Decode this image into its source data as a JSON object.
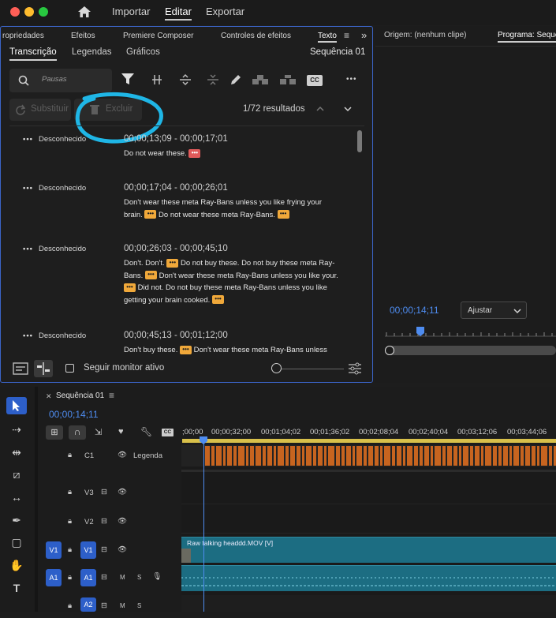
{
  "menu": {
    "items": [
      "Importar",
      "Editar",
      "Exportar"
    ],
    "active": "Editar"
  },
  "panel_tabs": [
    "ropriedades",
    "Efeitos",
    "Premiere Composer",
    "Controles de efeitos",
    "Texto",
    "≡",
    "»"
  ],
  "sub_tabs": {
    "items": [
      "Transcrição",
      "Legendas",
      "Gráficos"
    ],
    "active": "Transcrição",
    "sequence": "Sequência 01"
  },
  "search": {
    "placeholder": "Pausas"
  },
  "toolbar": {
    "cc_label": "CC",
    "more": "•••"
  },
  "actions": {
    "replace_label": "Substituir",
    "delete_label": "Excluir",
    "results": "1/72 resultados"
  },
  "transcript": [
    {
      "speaker": "Desconhecido",
      "timecode": "00;00;13;09 - 00;00;17;01",
      "lines": [
        "Do not wear these. [red]"
      ]
    },
    {
      "speaker": "Desconhecido",
      "timecode": "00;00;17;04 - 00;00;26;01",
      "lines": [
        "Don't wear these meta Ray-Bans unless you like frying your",
        "brain. [p] Do not wear these meta Ray-Bans. [p]"
      ]
    },
    {
      "speaker": "Desconhecido",
      "timecode": "00;00;26;03 - 00;00;45;10",
      "lines": [
        "Don't. Don't. [p] Do not buy these. Do not buy these meta Ray-",
        "Bans. [p] Don't wear these meta Ray-Bans unless you like your.",
        "[p] Did not. Do not buy these meta Ray-Bans unless you like",
        "getting your brain cooked. [p]"
      ]
    },
    {
      "speaker": "Desconhecido",
      "timecode": "00;00;45;13 - 00;01;12;00",
      "lines": [
        "Don't buy these. [p] Don't wear these meta Ray-Bans unless"
      ]
    }
  ],
  "footer": {
    "follow_label": "Seguir monitor ativo"
  },
  "source_monitor": {
    "title": "Origem: (nenhum clipe)"
  },
  "program_monitor": {
    "title": "Programa: Sequê",
    "timecode": "00;00;14;11",
    "fit_label": "Ajustar"
  },
  "timeline": {
    "tab": "Sequência 01",
    "timecode": "00;00;14;11",
    "ruler": [
      ";00;00",
      "00;00;32;00",
      "00;01;04;02",
      "00;01;36;02",
      "00;02;08;04",
      "00;02;40;04",
      "00;03;12;06",
      "00;03;44;06"
    ],
    "tracks": [
      {
        "name": "C1",
        "label": "Legenda"
      },
      {
        "name": "V3"
      },
      {
        "name": "V2"
      },
      {
        "name": "V1",
        "src": "V1"
      },
      {
        "name": "A1",
        "src": "A1",
        "m": "M",
        "s": "S"
      },
      {
        "name": "A2",
        "m": "M",
        "s": "S"
      }
    ],
    "clip_label": "Raw talking headdd.MOV [V]"
  },
  "colors": {
    "accent": "#3b64c8",
    "caption": "#c7641f",
    "video": "#1c6d82",
    "pause": "#f0a83a",
    "circle": "#1fb6e6"
  }
}
